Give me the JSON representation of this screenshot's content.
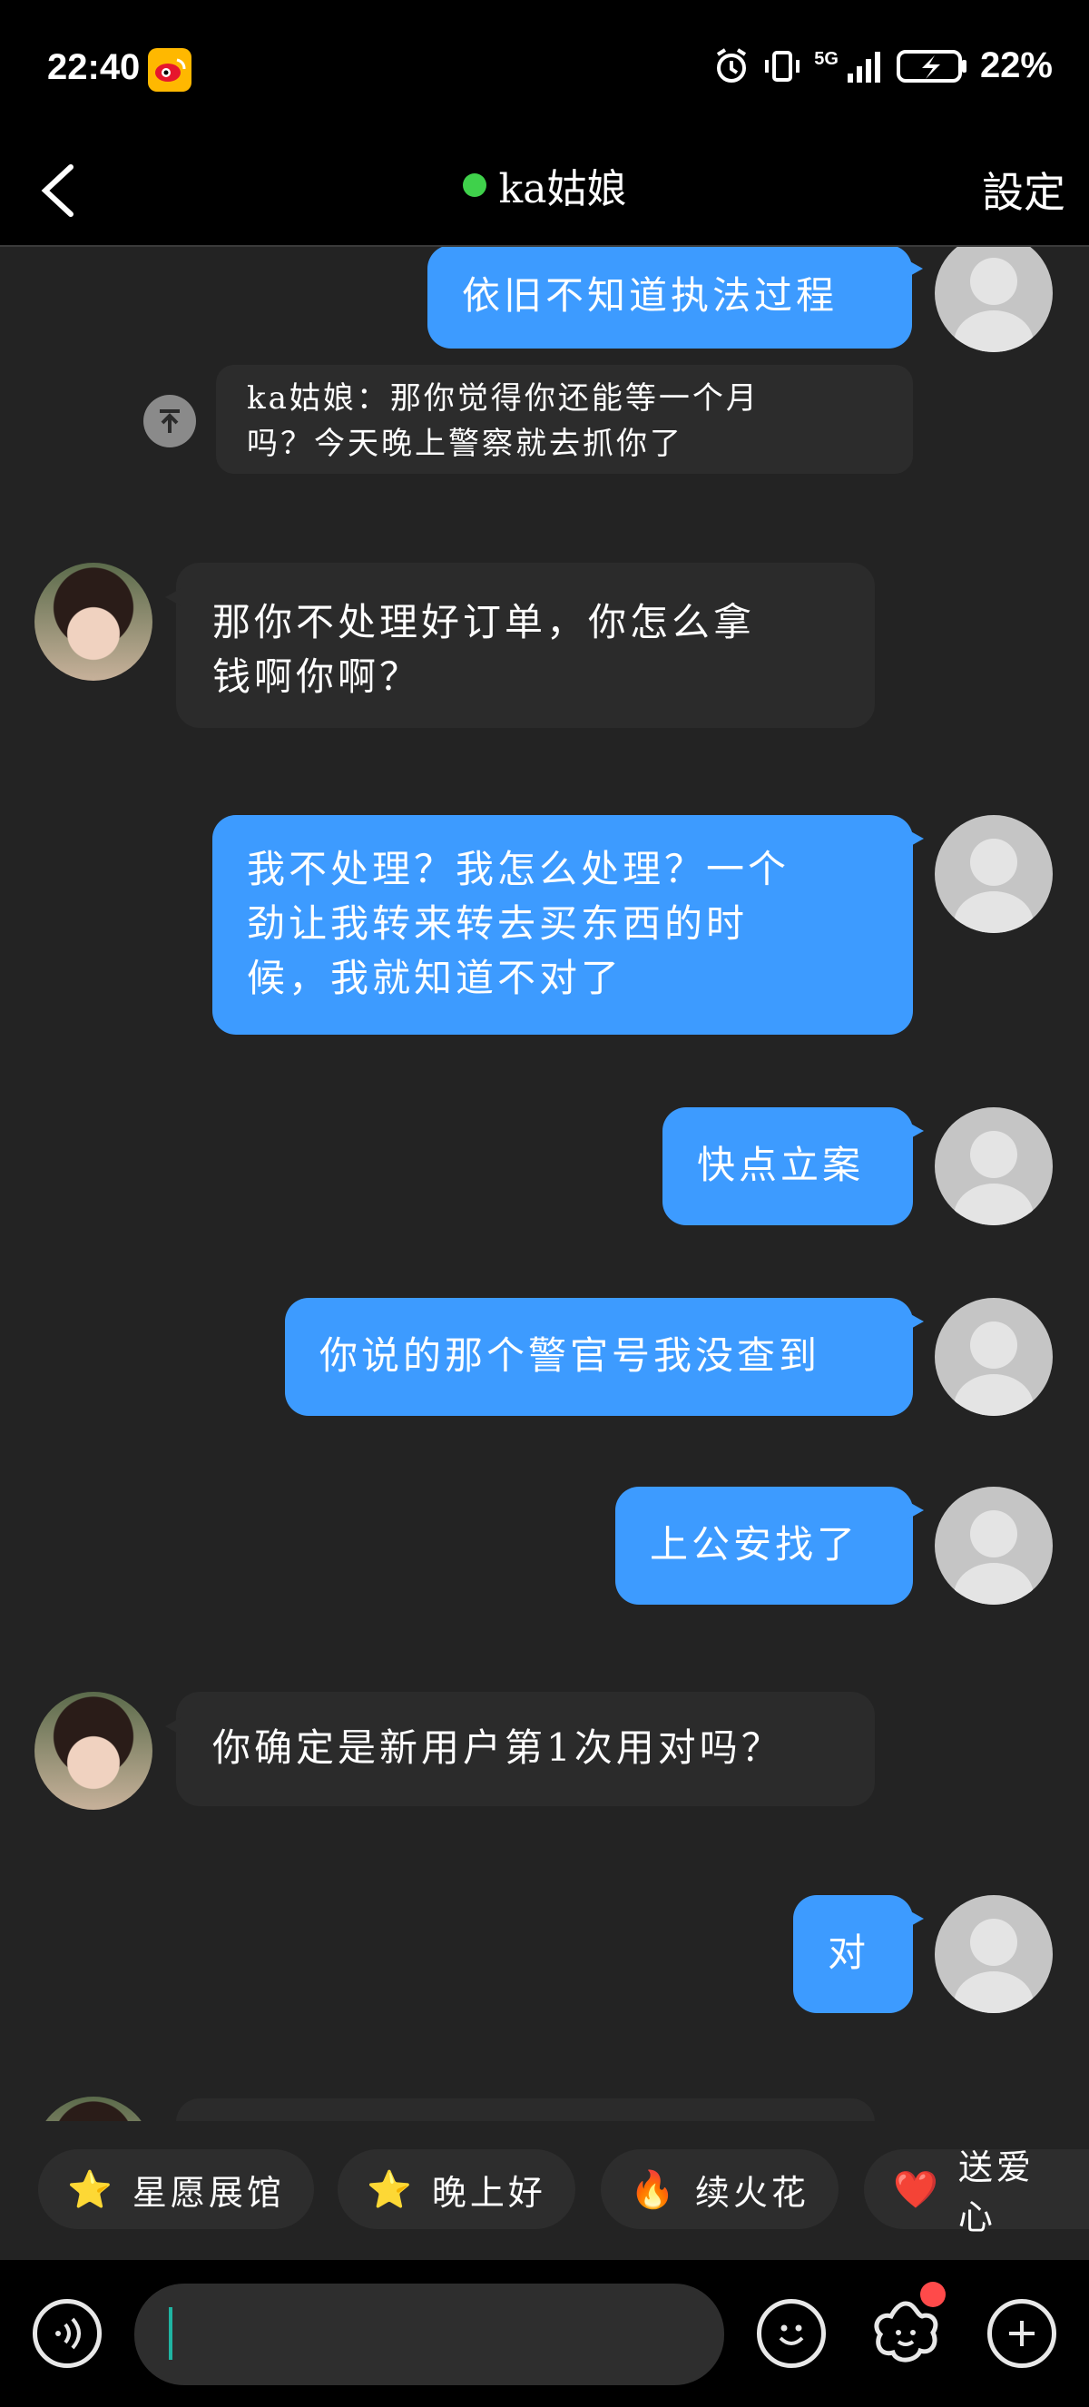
{
  "status_bar": {
    "time": "22:40",
    "network": "5G",
    "battery": "22%"
  },
  "header": {
    "title": "ka姑娘",
    "settings_label": "設定"
  },
  "quote": {
    "text_line1": "ka姑娘：那你觉得你还能等一个月",
    "text_line2": "吗？今天晚上警察就去抓你了"
  },
  "messages": [
    {
      "sender": "me",
      "lines": [
        "依旧不知道执法过程"
      ]
    },
    {
      "sender": "her",
      "lines": [
        "那你不处理好订单，你怎么拿",
        "钱啊你啊？"
      ]
    },
    {
      "sender": "me",
      "lines": [
        "我不处理？我怎么处理？一个",
        "劲让我转来转去买东西的时",
        "候，我就知道不对了"
      ]
    },
    {
      "sender": "me",
      "lines": [
        "快点立案"
      ]
    },
    {
      "sender": "me",
      "lines": [
        "你说的那个警官号我没查到"
      ]
    },
    {
      "sender": "me",
      "lines": [
        "上公安找了"
      ]
    },
    {
      "sender": "her",
      "lines": [
        "你确定是新用户第1次用对吗？"
      ]
    },
    {
      "sender": "me",
      "lines": [
        "对"
      ]
    }
  ],
  "quick_replies": [
    {
      "label": "星愿展馆",
      "icon": "⭐"
    },
    {
      "label": "晚上好",
      "icon": "⭐"
    },
    {
      "label": "续火花",
      "icon": "🔥"
    },
    {
      "label": "送爱心",
      "icon": "❤️"
    }
  ],
  "input": {
    "placeholder": ""
  }
}
